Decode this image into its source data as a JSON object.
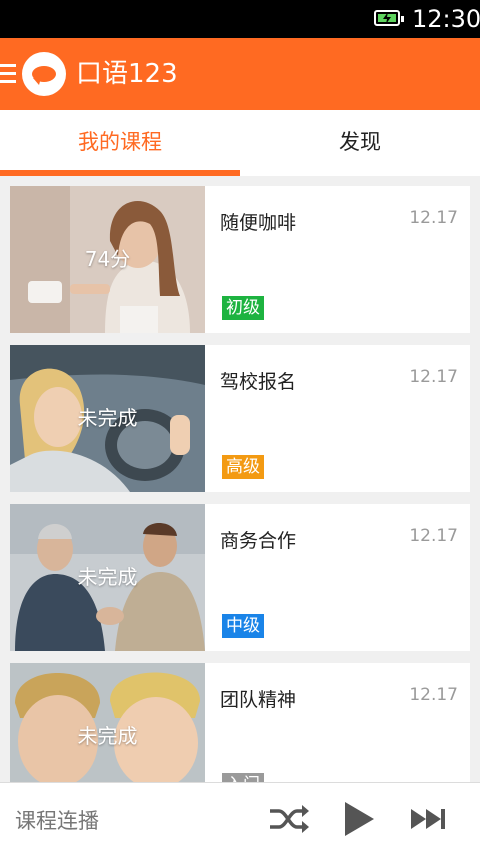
{
  "status_bar": {
    "time": "12:30",
    "battery_icon": "battery-charging-icon"
  },
  "app_bar": {
    "menu_icon": "menu-icon",
    "logo_icon": "chat-bubble-logo-icon",
    "title": "口语123"
  },
  "tabs": [
    {
      "label": "我的课程",
      "active": true
    },
    {
      "label": "发现",
      "active": false
    }
  ],
  "colors": {
    "accent": "#ff6a22",
    "level_beginner": "#1db340",
    "level_advanced": "#f39a12",
    "level_intermediate": "#1a84e8",
    "level_entry": "#9a9a9a"
  },
  "courses": [
    {
      "title": "随便咖啡",
      "date": "12.17",
      "status": "74分",
      "level": "初级",
      "level_color": "#1db340"
    },
    {
      "title": "驾校报名",
      "date": "12.17",
      "status": "未完成",
      "level": "高级",
      "level_color": "#f39a12"
    },
    {
      "title": "商务合作",
      "date": "12.17",
      "status": "未完成",
      "level": "中级",
      "level_color": "#1a84e8"
    },
    {
      "title": "团队精神",
      "date": "12.17",
      "status": "未完成",
      "level": "入门",
      "level_color": "#9a9a9a"
    }
  ],
  "bottom_bar": {
    "label": "课程连播",
    "shuffle_icon": "shuffle-icon",
    "play_icon": "play-icon",
    "next_icon": "skip-next-icon"
  }
}
